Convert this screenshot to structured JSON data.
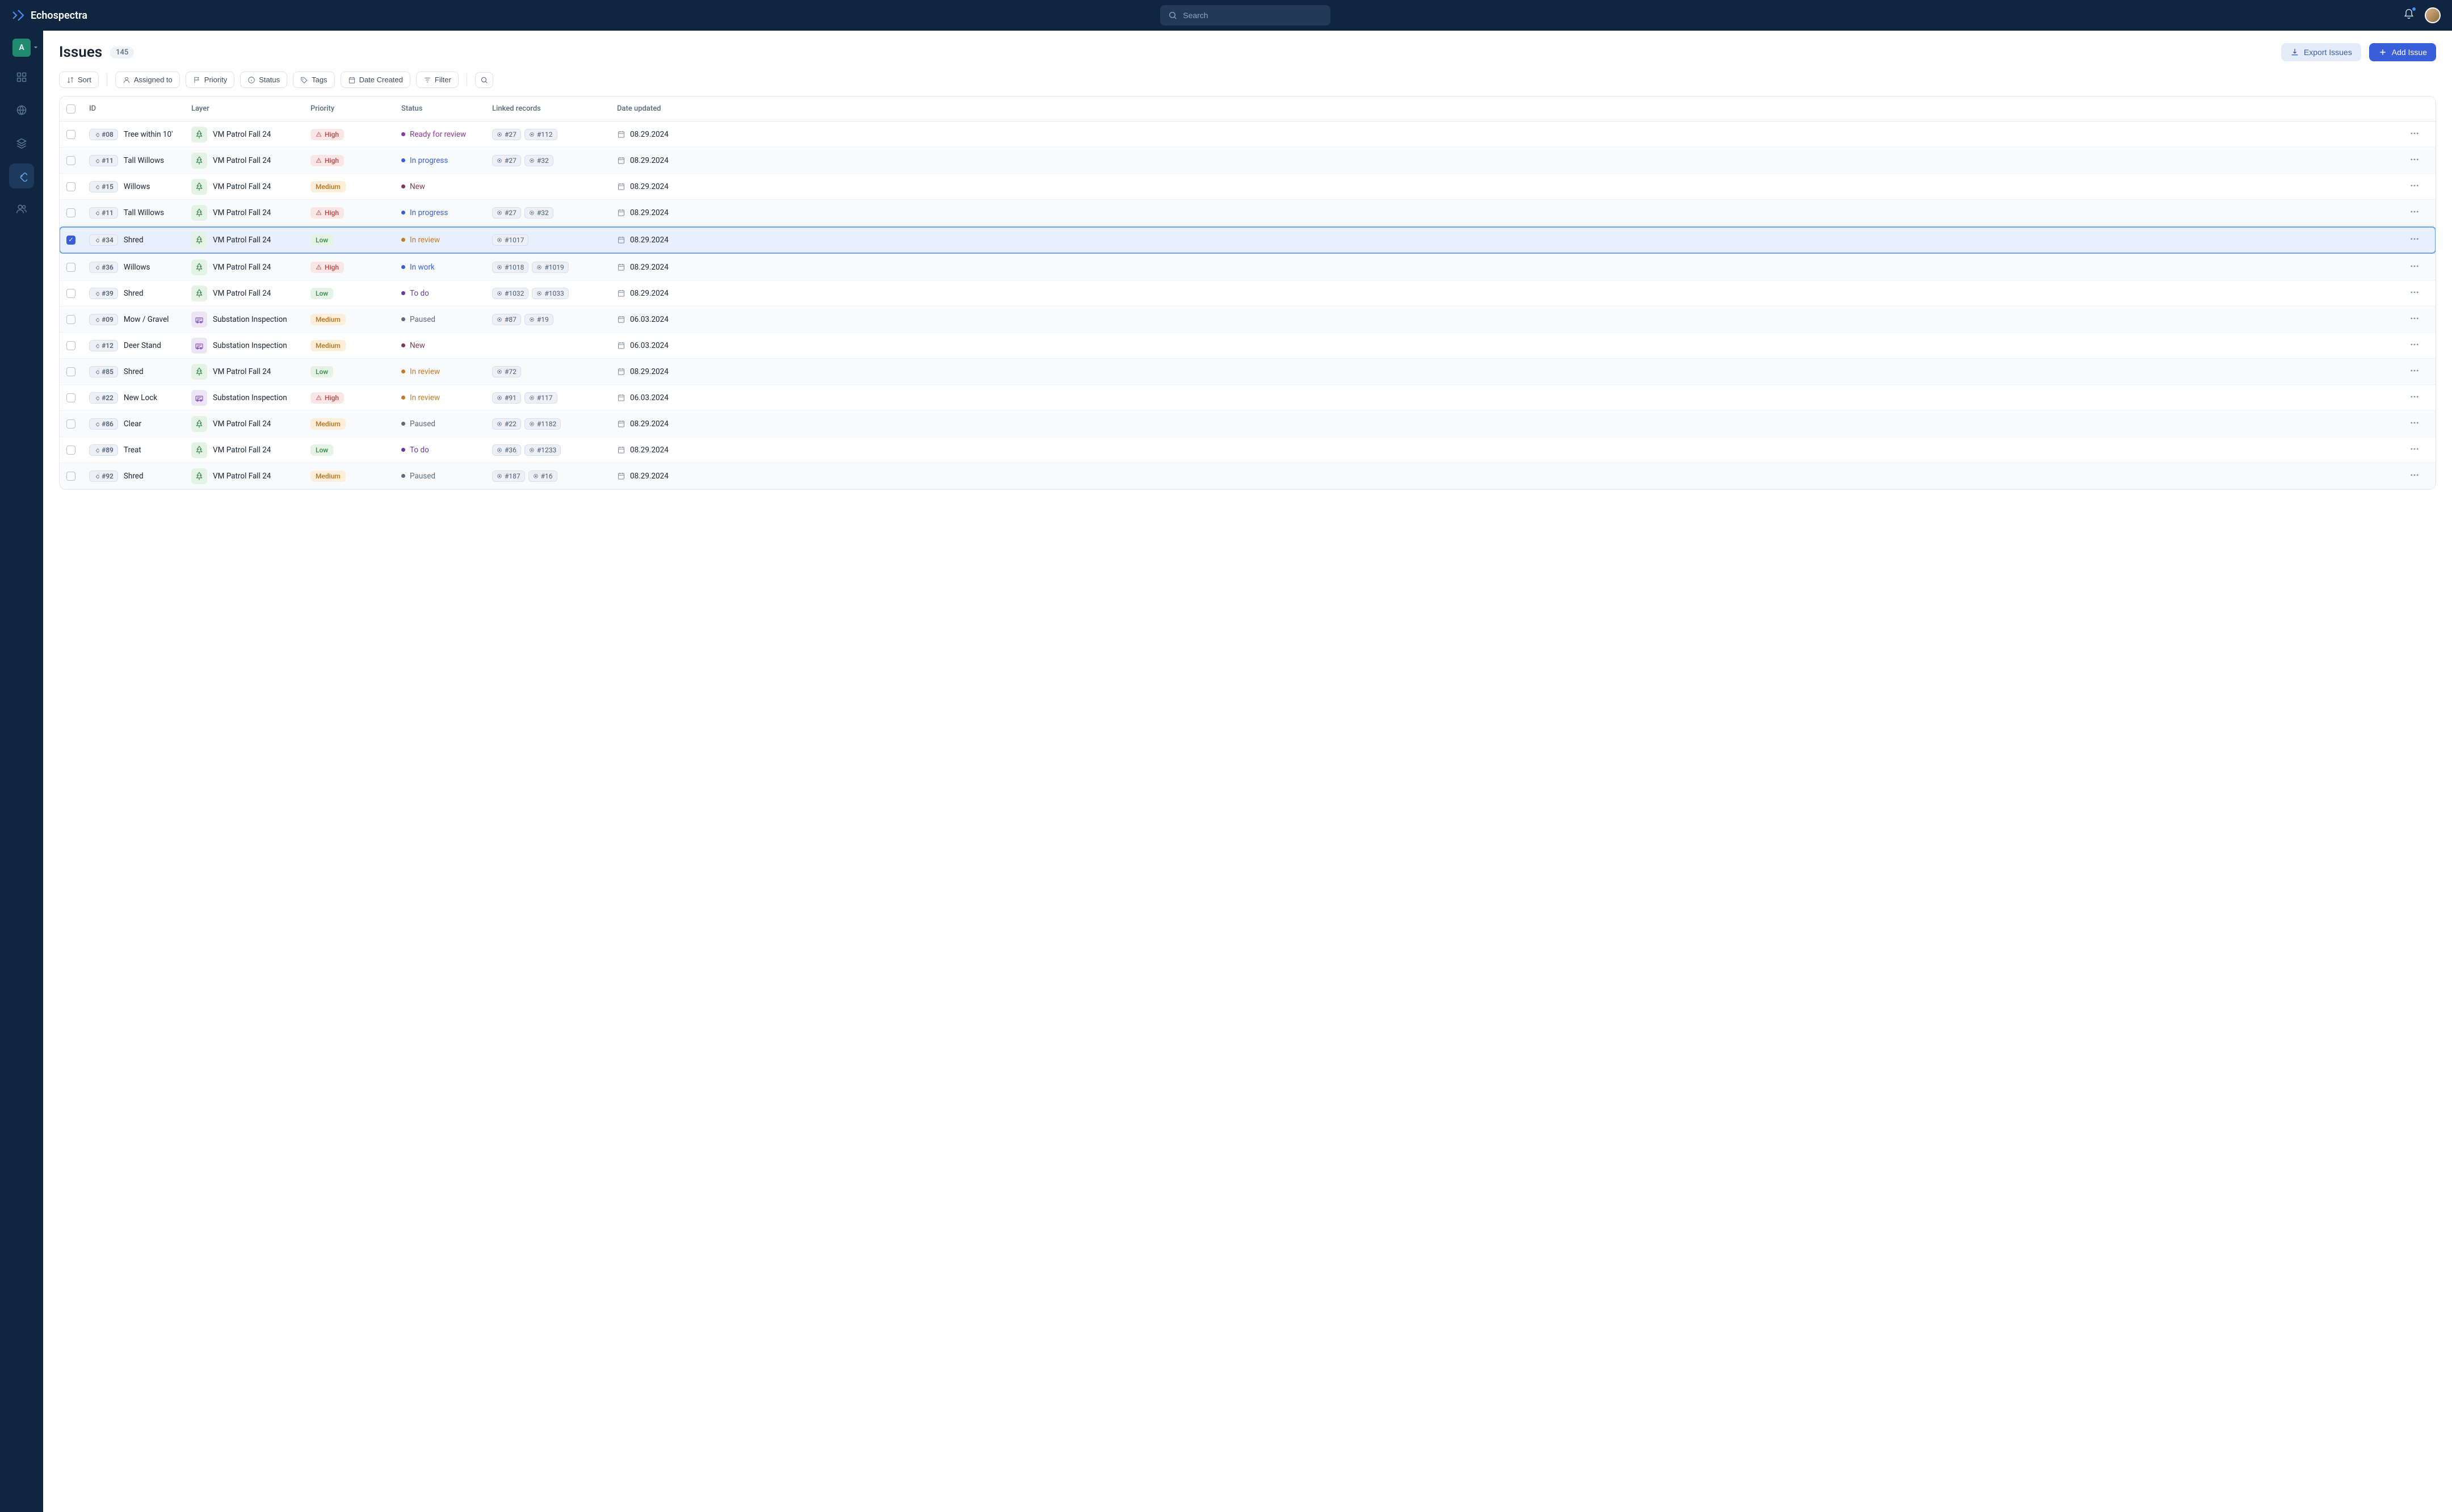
{
  "brand": "Echospectra",
  "search": {
    "placeholder": "Search"
  },
  "org_letter": "A",
  "page": {
    "title": "Issues",
    "count": "145"
  },
  "actions": {
    "export": "Export  Issues",
    "add": "Add Issue"
  },
  "toolbar": {
    "sort": "Sort",
    "assigned": "Assigned to",
    "priority": "Priority",
    "status": "Status",
    "tags": "Tags",
    "date_created": "Date Created",
    "filter": "Filter"
  },
  "columns": {
    "id": "ID",
    "layer": "Layer",
    "priority": "Priority",
    "status": "Status",
    "linked": "Linked records",
    "date": "Date updated"
  },
  "rows": [
    {
      "id": "#08",
      "title": "Tree  within 10'",
      "layer": "VM Patrol Fall 24",
      "layer_type": "tree",
      "priority": "High",
      "priority_cls": "high",
      "status": "Ready for review",
      "status_cls": "ready",
      "records": [
        "#27",
        "#112"
      ],
      "date": "08.29.2024",
      "selected": false
    },
    {
      "id": "#11",
      "title": "Tall Willows",
      "layer": "VM Patrol Fall 24",
      "layer_type": "tree",
      "priority": "High",
      "priority_cls": "high",
      "status": "In progress",
      "status_cls": "progress",
      "records": [
        "#27",
        "#32"
      ],
      "date": "08.29.2024",
      "selected": false
    },
    {
      "id": "#15",
      "title": "Willows",
      "layer": "VM Patrol Fall 24",
      "layer_type": "tree",
      "priority": "Medium",
      "priority_cls": "medium",
      "status": "New",
      "status_cls": "new",
      "records": [],
      "date": "08.29.2024",
      "selected": false
    },
    {
      "id": "#11",
      "title": "Tall Willows",
      "layer": "VM Patrol Fall 24",
      "layer_type": "tree",
      "priority": "High",
      "priority_cls": "high",
      "status": "In progress",
      "status_cls": "progress",
      "records": [
        "#27",
        "#32"
      ],
      "date": "08.29.2024",
      "selected": false
    },
    {
      "id": "#34",
      "title": "Shred",
      "layer": "VM Patrol Fall 24",
      "layer_type": "tree",
      "priority": "Low",
      "priority_cls": "low",
      "status": "In review",
      "status_cls": "review",
      "records": [
        "#1017"
      ],
      "date": "08.29.2024",
      "selected": true
    },
    {
      "id": "#36",
      "title": "Willows",
      "layer": "VM Patrol Fall 24",
      "layer_type": "tree",
      "priority": "High",
      "priority_cls": "high",
      "status": "In work",
      "status_cls": "work",
      "records": [
        "#1018",
        "#1019"
      ],
      "date": "08.29.2024",
      "selected": false
    },
    {
      "id": "#39",
      "title": "Shred",
      "layer": "VM Patrol Fall 24",
      "layer_type": "tree",
      "priority": "Low",
      "priority_cls": "low",
      "status": "To do",
      "status_cls": "todo",
      "records": [
        "#1032",
        "#1033"
      ],
      "date": "08.29.2024",
      "selected": false
    },
    {
      "id": "#09",
      "title": "Mow / Gravel",
      "layer": "Substation Inspection",
      "layer_type": "sub",
      "priority": "Medium",
      "priority_cls": "medium",
      "status": "Paused",
      "status_cls": "paused",
      "records": [
        "#87",
        "#19"
      ],
      "date": "06.03.2024",
      "selected": false
    },
    {
      "id": "#12",
      "title": "Deer Stand",
      "layer": "Substation Inspection",
      "layer_type": "sub",
      "priority": "Medium",
      "priority_cls": "medium",
      "status": "New",
      "status_cls": "new",
      "records": [],
      "date": "06.03.2024",
      "selected": false
    },
    {
      "id": "#85",
      "title": "Shred",
      "layer": "VM Patrol Fall 24",
      "layer_type": "tree",
      "priority": "Low",
      "priority_cls": "low",
      "status": "In review",
      "status_cls": "review",
      "records": [
        "#72"
      ],
      "date": "08.29.2024",
      "selected": false
    },
    {
      "id": "#22",
      "title": "New Lock",
      "layer": "Substation Inspection",
      "layer_type": "sub",
      "priority": "High",
      "priority_cls": "high",
      "status": "In review",
      "status_cls": "review",
      "records": [
        "#91",
        "#117"
      ],
      "date": "06.03.2024",
      "selected": false
    },
    {
      "id": "#86",
      "title": "Clear",
      "layer": "VM Patrol Fall 24",
      "layer_type": "tree",
      "priority": "Medium",
      "priority_cls": "medium",
      "status": "Paused",
      "status_cls": "paused",
      "records": [
        "#22",
        "#1182"
      ],
      "date": "08.29.2024",
      "selected": false
    },
    {
      "id": "#89",
      "title": "Treat",
      "layer": "VM Patrol Fall 24",
      "layer_type": "tree",
      "priority": "Low",
      "priority_cls": "low",
      "status": "To do",
      "status_cls": "todo",
      "records": [
        "#36",
        "#1233"
      ],
      "date": "08.29.2024",
      "selected": false
    },
    {
      "id": "#92",
      "title": "Shred",
      "layer": "VM Patrol Fall 24",
      "layer_type": "tree",
      "priority": "Medium",
      "priority_cls": "medium",
      "status": "Paused",
      "status_cls": "paused",
      "records": [
        "#187",
        "#16"
      ],
      "date": "08.29.2024",
      "selected": false
    }
  ]
}
